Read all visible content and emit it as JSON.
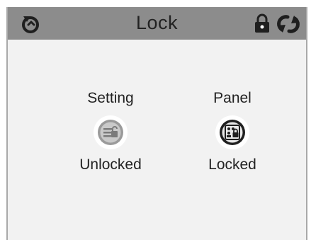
{
  "header": {
    "title": "Lock",
    "left_icon": "back-icon",
    "right_icons": [
      "lock-icon",
      "refresh-icon"
    ]
  },
  "items": [
    {
      "name": "Setting",
      "status": "Unlocked",
      "icon": "settings-unlocked-icon"
    },
    {
      "name": "Panel",
      "status": "Locked",
      "icon": "panel-locked-icon"
    }
  ],
  "colors": {
    "titlebar": "#8c8c8c",
    "background": "#f2f2f2",
    "icon_dark": "#1f1f1f",
    "icon_inactive": "#8a8a8a"
  }
}
